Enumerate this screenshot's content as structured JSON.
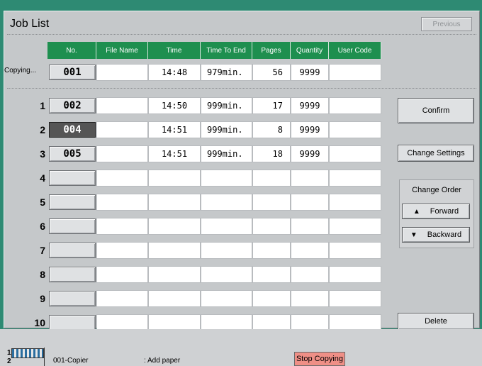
{
  "screen": {
    "title": "Job List",
    "previous_label": "Previous"
  },
  "table": {
    "headers": [
      "No.",
      "File Name",
      "Time",
      "Time To End",
      "Pages",
      "Quantity",
      "User Code"
    ],
    "copying_label": "Copying...",
    "copying_row": {
      "job": "001",
      "file": "",
      "time": "14:48",
      "time_to_end": "979min.",
      "pages": "56",
      "quantity": "9999",
      "user_code": ""
    },
    "rows": [
      {
        "index": "1",
        "job": "002",
        "file": "",
        "time": "14:50",
        "time_to_end": "999min.",
        "pages": "17",
        "quantity": "9999",
        "user_code": ""
      },
      {
        "index": "2",
        "job": "004",
        "file": "",
        "time": "14:51",
        "time_to_end": "999min.",
        "pages": "8",
        "quantity": "9999",
        "user_code": ""
      },
      {
        "index": "3",
        "job": "005",
        "file": "",
        "time": "14:51",
        "time_to_end": "999min.",
        "pages": "18",
        "quantity": "9999",
        "user_code": ""
      },
      {
        "index": "4",
        "job": "",
        "file": "",
        "time": "",
        "time_to_end": "",
        "pages": "",
        "quantity": "",
        "user_code": ""
      },
      {
        "index": "5",
        "job": "",
        "file": "",
        "time": "",
        "time_to_end": "",
        "pages": "",
        "quantity": "",
        "user_code": ""
      },
      {
        "index": "6",
        "job": "",
        "file": "",
        "time": "",
        "time_to_end": "",
        "pages": "",
        "quantity": "",
        "user_code": ""
      },
      {
        "index": "7",
        "job": "",
        "file": "",
        "time": "",
        "time_to_end": "",
        "pages": "",
        "quantity": "",
        "user_code": ""
      },
      {
        "index": "8",
        "job": "",
        "file": "",
        "time": "",
        "time_to_end": "",
        "pages": "",
        "quantity": "",
        "user_code": ""
      },
      {
        "index": "9",
        "job": "",
        "file": "",
        "time": "",
        "time_to_end": "",
        "pages": "",
        "quantity": "",
        "user_code": ""
      },
      {
        "index": "10",
        "job": "",
        "file": "",
        "time": "",
        "time_to_end": "",
        "pages": "",
        "quantity": "",
        "user_code": ""
      }
    ],
    "selected_job": "004"
  },
  "side": {
    "confirm_label": "Confirm",
    "change_settings_label": "Change Settings",
    "change_order_title": "Change Order",
    "forward_label": "Forward",
    "backward_label": "Backward",
    "delete_label": "Delete"
  },
  "status_bar": {
    "tray_number": "1",
    "tray_number_2": "2",
    "job_text": "001-Copier",
    "message": ": Add paper",
    "stop_label": "Stop Copying"
  },
  "colors": {
    "header_green": "#1e8f4f",
    "background_teal": "#2e8a73",
    "stop_button": "#ef8f86"
  }
}
